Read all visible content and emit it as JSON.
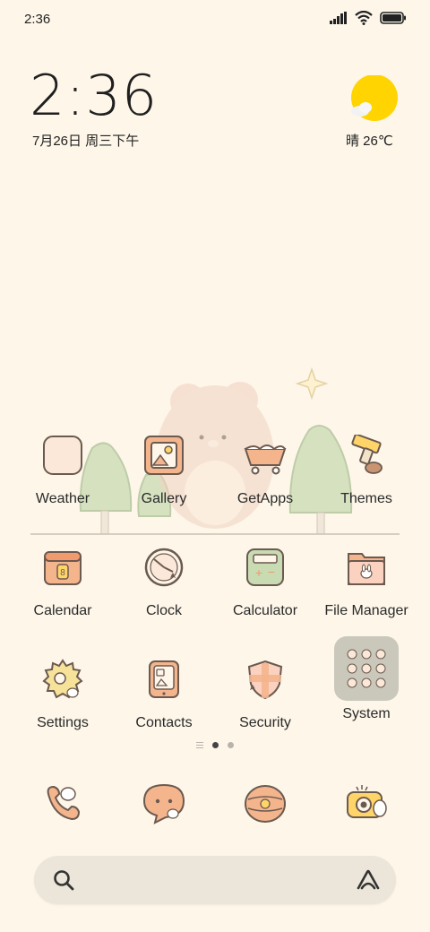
{
  "status_bar": {
    "time": "2:36"
  },
  "widget": {
    "time": "2:36",
    "date": "7月26日 周三下午",
    "weather": "晴 26℃"
  },
  "apps": [
    {
      "label": "Weather",
      "icon": "weather-icon"
    },
    {
      "label": "Gallery",
      "icon": "gallery-icon"
    },
    {
      "label": "GetApps",
      "icon": "getapps-icon"
    },
    {
      "label": "Themes",
      "icon": "themes-icon"
    },
    {
      "label": "Calendar",
      "icon": "calendar-icon"
    },
    {
      "label": "Clock",
      "icon": "clock-icon"
    },
    {
      "label": "Calculator",
      "icon": "calculator-icon"
    },
    {
      "label": "File Manager",
      "icon": "file-manager-icon"
    },
    {
      "label": "Settings",
      "icon": "settings-icon"
    },
    {
      "label": "Contacts",
      "icon": "contacts-icon"
    },
    {
      "label": "Security",
      "icon": "security-icon"
    },
    {
      "label": "System",
      "icon": "folder-icon"
    }
  ],
  "calendar_day": "8",
  "dock": [
    {
      "icon": "phone-icon"
    },
    {
      "icon": "messages-icon"
    },
    {
      "icon": "browser-icon"
    },
    {
      "icon": "camera-icon"
    }
  ],
  "page_indicator": {
    "pages": 2,
    "current": 1
  },
  "colors": {
    "background": "#fdf6e9",
    "sun": "#ffd400",
    "search_bar": "#ece6da"
  }
}
